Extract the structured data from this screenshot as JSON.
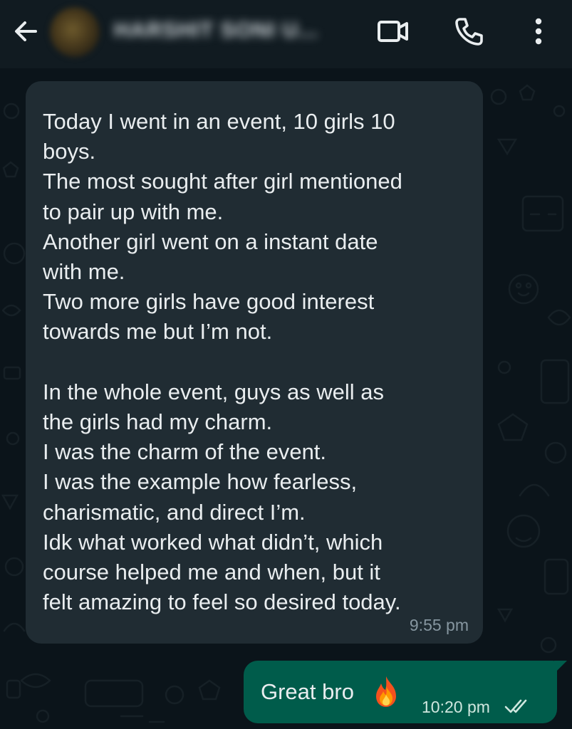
{
  "header": {
    "back_icon": "arrow-left-icon",
    "contact_name": "HARSHIT SONI U...",
    "video_icon": "video-camera-icon",
    "call_icon": "phone-icon",
    "menu_icon": "more-vertical-icon"
  },
  "messages": {
    "incoming": {
      "lines": [
        "Today I went in an event, 10 girls 10",
        "boys.",
        "The most sought after girl mentioned",
        "to pair up with me.",
        "Another girl went on a instant date",
        "with me.",
        "Two more girls have good interest",
        "towards me but I’m not.",
        "",
        "In the whole event, guys as well as",
        "the girls had my charm.",
        "I was the charm of the event.",
        "I was the example how fearless,",
        "charismatic, and direct I’m.",
        "Idk what worked what didn’t, which",
        "course helped me and when, but it",
        "felt amazing to feel so desired today."
      ],
      "time": "9:55 pm"
    },
    "outgoing": {
      "text": "Great bro",
      "emoji_icon": "fire-emoji-icon",
      "time": "10:20 pm",
      "status_icon": "double-check-icon"
    }
  },
  "colors": {
    "background": "#0b141a",
    "header": "#111b21",
    "incoming_bubble": "#202c33",
    "outgoing_bubble": "#005c4b",
    "text": "#e9edef",
    "timestamp": "#8696a0",
    "icon": "#e9edef"
  }
}
